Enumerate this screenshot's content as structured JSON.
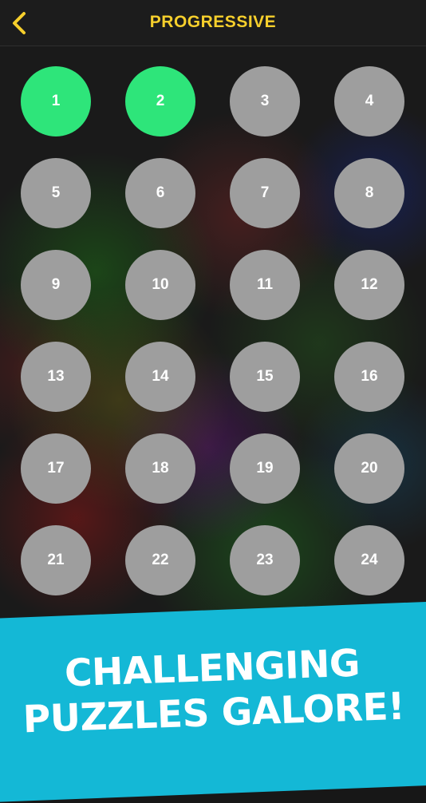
{
  "header": {
    "title": "PROGRESSIVE",
    "back_icon": "chevron-left-icon",
    "accent_color": "#f6cf2c"
  },
  "levels": [
    {
      "label": "1",
      "completed": true
    },
    {
      "label": "2",
      "completed": true
    },
    {
      "label": "3",
      "completed": false
    },
    {
      "label": "4",
      "completed": false
    },
    {
      "label": "5",
      "completed": false
    },
    {
      "label": "6",
      "completed": false
    },
    {
      "label": "7",
      "completed": false
    },
    {
      "label": "8",
      "completed": false
    },
    {
      "label": "9",
      "completed": false
    },
    {
      "label": "10",
      "completed": false
    },
    {
      "label": "11",
      "completed": false
    },
    {
      "label": "12",
      "completed": false
    },
    {
      "label": "13",
      "completed": false
    },
    {
      "label": "14",
      "completed": false
    },
    {
      "label": "15",
      "completed": false
    },
    {
      "label": "16",
      "completed": false
    },
    {
      "label": "17",
      "completed": false
    },
    {
      "label": "18",
      "completed": false
    },
    {
      "label": "19",
      "completed": false
    },
    {
      "label": "20",
      "completed": false
    },
    {
      "label": "21",
      "completed": false
    },
    {
      "label": "22",
      "completed": false
    },
    {
      "label": "23",
      "completed": false
    },
    {
      "label": "24",
      "completed": false
    },
    {
      "label": "",
      "completed": false
    },
    {
      "label": "",
      "completed": false
    },
    {
      "label": "",
      "completed": false
    },
    {
      "label": "",
      "completed": false
    }
  ],
  "colors": {
    "completed": "#2ee57a",
    "locked": "#9e9e9e",
    "banner": "#14b8d6"
  },
  "banner": {
    "line1": "CHALLENGING",
    "line2": "PUZZLES GALORE!"
  }
}
